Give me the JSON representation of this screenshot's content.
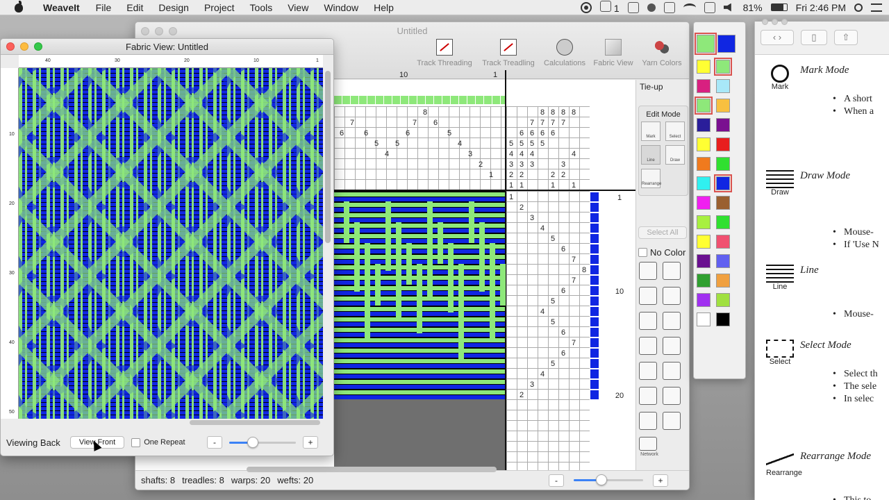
{
  "menubar": {
    "app_name": "WeaveIt",
    "items": [
      "File",
      "Edit",
      "Design",
      "Project",
      "Tools",
      "View",
      "Window",
      "Help"
    ],
    "status_1": "1",
    "battery": "81%",
    "clock": "Fri 2:46 PM"
  },
  "main_window": {
    "title": "Untitled",
    "toolbar": [
      {
        "label": "Track Threading",
        "icon": "track-threading-icon"
      },
      {
        "label": "Track Treadling",
        "icon": "track-treadling-icon"
      },
      {
        "label": "Calculations",
        "icon": "calculations-icon"
      },
      {
        "label": "Fabric View",
        "icon": "fabric-view-icon"
      },
      {
        "label": "Yarn Colors",
        "icon": "yarn-colors-icon"
      }
    ],
    "threading_numbers": {
      "ten": "10",
      "one": "1"
    },
    "threading_row_labels": [
      "8",
      "7",
      "7",
      "6",
      "6",
      "6",
      "6",
      "5",
      "5",
      "5",
      "4",
      "4",
      "3",
      "2",
      "1"
    ],
    "tieup_numbers": [
      "8",
      "8",
      "8",
      "8",
      "7",
      "7",
      "7",
      "7",
      "6",
      "6",
      "6",
      "6",
      "5",
      "5",
      "5",
      "5",
      "4",
      "4",
      "4",
      "4",
      "3",
      "3",
      "3",
      "3",
      "2",
      "2",
      "2",
      "2",
      "1",
      "1",
      "1",
      "1"
    ],
    "treadling_numbers": [
      "1",
      "2",
      "3",
      "4",
      "5",
      "6",
      "7",
      "8",
      "7",
      "6",
      "5",
      "4",
      "5",
      "6",
      "7",
      "6",
      "5",
      "4",
      "3",
      "2"
    ],
    "weft_labels": {
      "one": "1",
      "ten": "10",
      "twenty": "20"
    },
    "side_panel": {
      "tieup_label": "Tie-up",
      "edit_mode_label": "Edit Mode",
      "mode_buttons": [
        "Mark",
        "Select",
        "Line",
        "Draw",
        "Rearrange"
      ],
      "select_all": "Select All",
      "no_color": "No Color",
      "network_label": "Network"
    },
    "status": {
      "shafts": "shafts: 8",
      "treadles": "treadles: 8",
      "warps": "warps: 20",
      "wefts": "wefts: 20"
    },
    "zoom_minus": "-",
    "zoom_plus": "+",
    "zoom_level": 0.4
  },
  "fabric_window": {
    "title": "Fabric View: Untitled",
    "ruler_top": [
      "40",
      "30",
      "20",
      "10",
      "1"
    ],
    "ruler_left": [
      "10",
      "20",
      "30",
      "40",
      "50"
    ],
    "viewing_label": "Viewing Back",
    "view_front_button": "View Front",
    "one_repeat_label": "One Repeat",
    "zoom_minus": "-",
    "zoom_plus": "+",
    "zoom_level": 0.35
  },
  "palette": {
    "colors": {
      "primary_green": "#8ee87a",
      "primary_blue": "#1026e2"
    },
    "swatches": [
      [
        "#ffff33",
        "#8ee87a"
      ],
      [
        "#d82080",
        "#a8e8f8"
      ],
      [
        "#8ee87a",
        "#f8c040"
      ],
      [
        "#2a1e9a",
        "#7a1090"
      ],
      [
        "#ffff33",
        "#e81e1e"
      ],
      [
        "#f07a1e",
        "#30e030"
      ],
      [
        "#30f0f0",
        "#1026e2"
      ],
      [
        "#f020f0",
        "#9a6030"
      ],
      [
        "#a8f040",
        "#30e030"
      ],
      [
        "#ffff33",
        "#f05070"
      ],
      [
        "#6a1090",
        "#6060f0"
      ],
      [
        "#30a030",
        "#f0a040"
      ],
      [
        "#a030f0",
        "#a0e040"
      ],
      [
        "#ffffff",
        "#000000"
      ]
    ]
  },
  "help": {
    "sections": [
      {
        "title": "Mark Mode",
        "caption": "Mark",
        "bullets": [
          "A short",
          "When a"
        ]
      },
      {
        "title": "Draw Mode",
        "caption": "Draw",
        "bullets": [
          "Mouse-",
          "If 'Use N"
        ]
      },
      {
        "title": "Line",
        "caption": "Line",
        "bullets": [
          "Mouse-"
        ]
      },
      {
        "title": "Select Mode",
        "caption": "Select",
        "bullets": [
          "Select th",
          "The sele",
          "In selec"
        ]
      },
      {
        "title": "Rearrange Mode",
        "caption": "Rearrange",
        "bullets": [
          "This to"
        ]
      }
    ]
  }
}
